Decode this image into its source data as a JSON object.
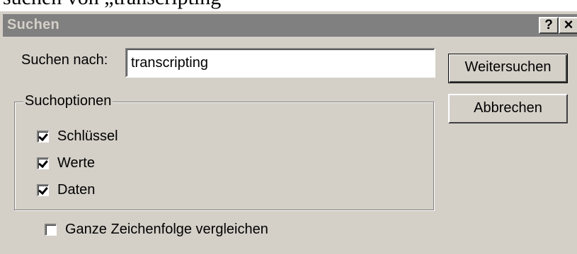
{
  "page_caption": "suchen von „transcripting",
  "dialog": {
    "title": "Suchen",
    "help_button": "?",
    "close_button": "×",
    "search_label": "Suchen nach:",
    "search_value": "transcripting",
    "find_next_label": "Weitersuchen",
    "cancel_label": "Abbrechen",
    "options_group_label": "Suchoptionen",
    "options": {
      "keys": {
        "label": "Schlüssel",
        "checked": true
      },
      "values": {
        "label": "Werte",
        "checked": true
      },
      "data": {
        "label": "Daten",
        "checked": true
      }
    },
    "whole_string": {
      "label": "Ganze Zeichenfolge vergleichen",
      "checked": false
    }
  },
  "colors": {
    "dialog_bg": "#d4d0c8",
    "title_bar_inactive": "#808080",
    "title_text": "#d4d0c8"
  }
}
